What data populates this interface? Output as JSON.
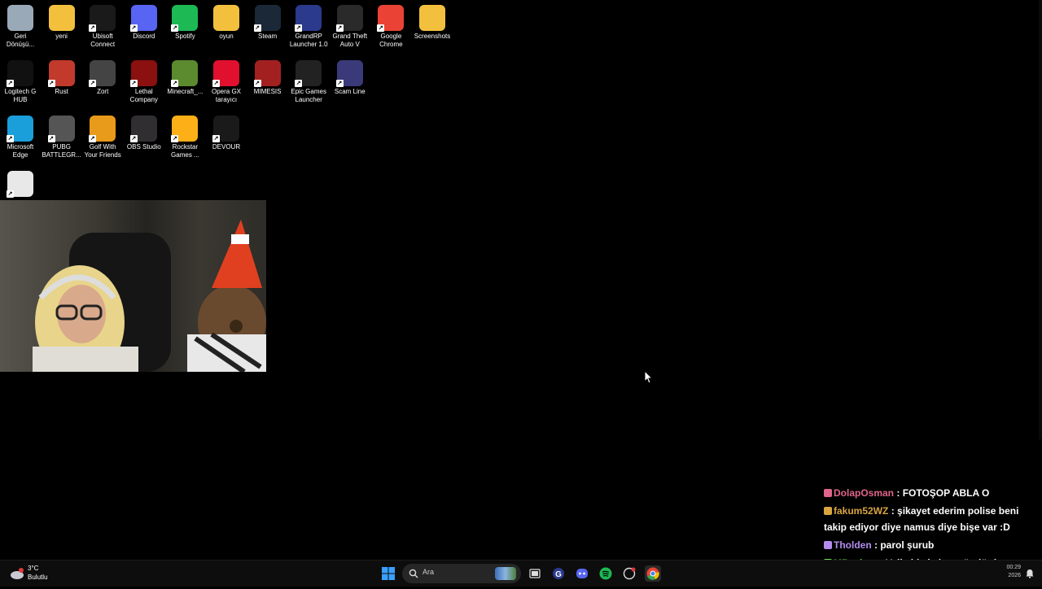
{
  "desktop": {
    "icons": [
      {
        "label": "Geri Dönüşü...",
        "icon": "recycle-bin-icon",
        "color": "#9aa9b8"
      },
      {
        "label": "yeni",
        "icon": "folder-icon",
        "color": "#f3c03e"
      },
      {
        "label": "Ubisoft Connect",
        "icon": "ubisoft-icon",
        "color": "#1a1a1a"
      },
      {
        "label": "Discord",
        "icon": "discord-icon",
        "color": "#5865f2"
      },
      {
        "label": "Spotify",
        "icon": "spotify-icon",
        "color": "#1db954"
      },
      {
        "label": "oyun",
        "icon": "folder-icon",
        "color": "#f3c03e"
      },
      {
        "label": "Steam",
        "icon": "steam-icon",
        "color": "#1b2838"
      },
      {
        "label": "GrandRP Launcher 1.0",
        "icon": "grandrp-icon",
        "color": "#2b3a8c"
      },
      {
        "label": "Grand Theft Auto V",
        "icon": "gta-icon",
        "color": "#2a2a2a"
      },
      {
        "label": "Google Chrome",
        "icon": "chrome-icon",
        "color": "#ea4335"
      },
      {
        "label": "Screenshots",
        "icon": "folder-icon",
        "color": "#f3c03e"
      },
      {
        "label": "Logitech G HUB",
        "icon": "logitech-icon",
        "color": "#111"
      },
      {
        "label": "Rust",
        "icon": "rust-icon",
        "color": "#c23a2c"
      },
      {
        "label": "Zort",
        "icon": "zort-icon",
        "color": "#444"
      },
      {
        "label": "Lethal Company",
        "icon": "lethal-company-icon",
        "color": "#8b1010"
      },
      {
        "label": "Minecraft_...",
        "icon": "minecraft-icon",
        "color": "#5b8a2f"
      },
      {
        "label": "Opera GX tarayıcı",
        "icon": "opera-gx-icon",
        "color": "#e0102e"
      },
      {
        "label": "MIMESIS",
        "icon": "mimesis-icon",
        "color": "#a32020"
      },
      {
        "label": "Epic Games Launcher",
        "icon": "epic-games-icon",
        "color": "#222"
      },
      {
        "label": "Scam Line",
        "icon": "scam-line-icon",
        "color": "#3a3a7a"
      },
      {
        "label": "Microsoft Edge",
        "icon": "edge-icon",
        "color": "#1a9fdb"
      },
      {
        "label": "PUBG BATTLEGR...",
        "icon": "pubg-icon",
        "color": "#555"
      },
      {
        "label": "Golf With Your Friends",
        "icon": "golf-icon",
        "color": "#e89a1a"
      },
      {
        "label": "OBS Studio",
        "icon": "obs-icon",
        "color": "#302e31"
      },
      {
        "label": "Rockstar Games ...",
        "icon": "rockstar-icon",
        "color": "#fcaf17"
      },
      {
        "label": "DEVOUR",
        "icon": "devour-icon",
        "color": "#1a1a1a"
      },
      {
        "label": "",
        "icon": "crab-game-icon",
        "color": "#e8e8e8"
      }
    ]
  },
  "chat": {
    "messages": [
      {
        "user": "DolapOsman",
        "user_color": "#e0658a",
        "text": ": FOTOŞOP ABLA O"
      },
      {
        "user": "fakum52WZ",
        "user_color": "#d9a441",
        "text": ": şikayet ederim polise beni takip ediyor diye namus diye bişe var :D"
      },
      {
        "user": "Tholden",
        "user_color": "#b48cf0",
        "text": ": parol şurub"
      },
      {
        "user": "MBozhan",
        "user_color": "#6ddf50",
        "text": ": Valla bizde kaç gündür hastayız abim vallâ bende açmıyorum"
      }
    ]
  },
  "taskbar": {
    "weather_temp": "3°C",
    "weather_desc": "Bulutlu",
    "search_placeholder": "Ara",
    "clock_time": "00:29",
    "clock_date": "2026"
  }
}
